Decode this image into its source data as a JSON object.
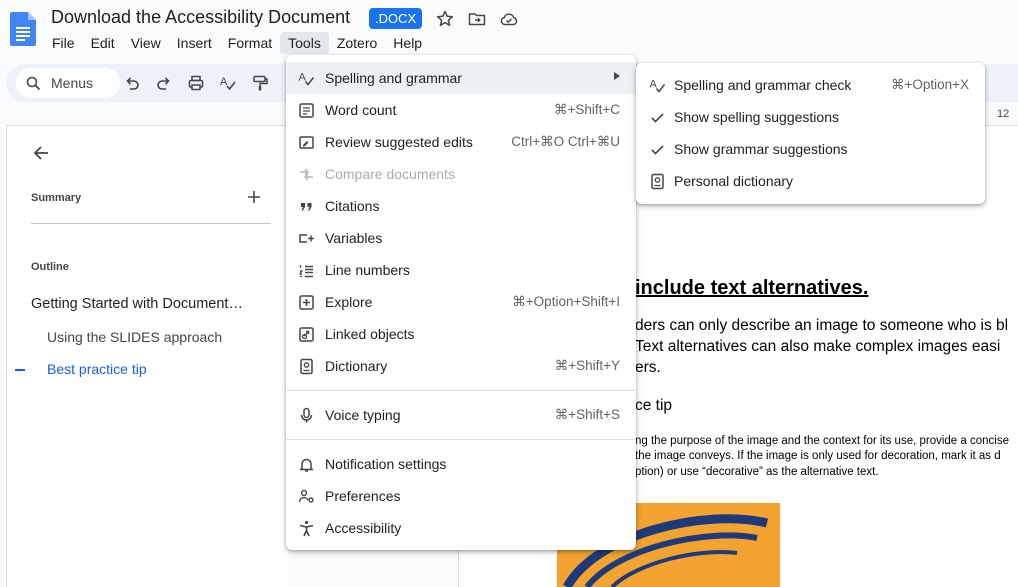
{
  "header": {
    "title": "Download the Accessibility Document",
    "badge": ".DOCX"
  },
  "menubar": {
    "items": [
      "File",
      "Edit",
      "View",
      "Insert",
      "Format",
      "Tools",
      "Zotero",
      "Help"
    ],
    "active": "Tools"
  },
  "toolbar": {
    "search_label": "Menus"
  },
  "outline_panel": {
    "summary_label": "Summary",
    "outline_label": "Outline",
    "items": [
      "Getting Started with Document…",
      "Using the SLIDES approach",
      "Best practice tip"
    ]
  },
  "tools_menu": {
    "items": [
      {
        "label": "Spelling and grammar",
        "shortcut": "",
        "icon": "spellcheck-icon"
      },
      {
        "label": "Word count",
        "shortcut": "⌘+Shift+C",
        "icon": "word-count-icon"
      },
      {
        "label": "Review suggested edits",
        "shortcut": "Ctrl+⌘O Ctrl+⌘U",
        "icon": "review-edits-icon"
      },
      {
        "label": "Compare documents",
        "shortcut": "",
        "icon": "compare-icon"
      },
      {
        "label": "Citations",
        "shortcut": "",
        "icon": "quote-icon"
      },
      {
        "label": "Variables",
        "shortcut": "",
        "icon": "variables-icon"
      },
      {
        "label": "Line numbers",
        "shortcut": "",
        "icon": "line-numbers-icon"
      },
      {
        "label": "Explore",
        "shortcut": "⌘+Option+Shift+I",
        "icon": "explore-icon"
      },
      {
        "label": "Linked objects",
        "shortcut": "",
        "icon": "linked-objects-icon"
      },
      {
        "label": "Dictionary",
        "shortcut": "⌘+Shift+Y",
        "icon": "dictionary-icon"
      },
      {
        "label": "Voice typing",
        "shortcut": "⌘+Shift+S",
        "icon": "microphone-icon"
      },
      {
        "label": "Notification settings",
        "shortcut": "",
        "icon": "bell-icon"
      },
      {
        "label": "Preferences",
        "shortcut": "",
        "icon": "preferences-icon"
      },
      {
        "label": "Accessibility",
        "shortcut": "",
        "icon": "accessibility-icon"
      }
    ]
  },
  "spelling_submenu": {
    "items": [
      {
        "label": "Spelling and grammar check",
        "shortcut": "⌘+Option+X",
        "icon": "spellcheck-icon"
      },
      {
        "label": "Show spelling suggestions",
        "shortcut": "",
        "icon": "check-icon"
      },
      {
        "label": "Show grammar suggestions",
        "shortcut": "",
        "icon": "check-icon"
      },
      {
        "label": "Personal dictionary",
        "shortcut": "",
        "icon": "dictionary-icon"
      }
    ]
  },
  "document": {
    "ruler_number": "12",
    "heading": "include text alternatives.",
    "para_lines": [
      "ders can only describe an image to someone who is bl",
      "Text alternatives can also make complex images easi",
      "ers."
    ],
    "subheading": "ce tip",
    "small_lines": [
      "ng the purpose of the image and the context for its use, provide a concise",
      "the image conveys. If the image is only used for decoration, mark it as d",
      "ption) or use “decorative” as the alternative text."
    ]
  }
}
